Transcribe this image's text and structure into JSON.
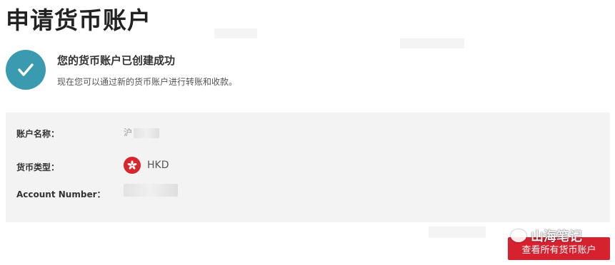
{
  "page": {
    "title": "申请货币账户"
  },
  "success": {
    "title": "您的货币账户已创建成功",
    "subtitle": "现在您可以通过新的货币账户进行转账和收款。"
  },
  "info": {
    "account_name_label": "账户名称：",
    "account_name_value": "沪",
    "currency_type_label": "货币类型：",
    "currency_code": "HKD",
    "account_number_label": "Account Number："
  },
  "actions": {
    "view_all_label": "查看所有货币账户"
  },
  "watermark": {
    "text": "山海笔记"
  },
  "icons": {
    "success": "check-icon",
    "flag": "hong-kong-flag-icon"
  },
  "colors": {
    "accent": "#3a9ab0",
    "button": "#d6212f"
  }
}
